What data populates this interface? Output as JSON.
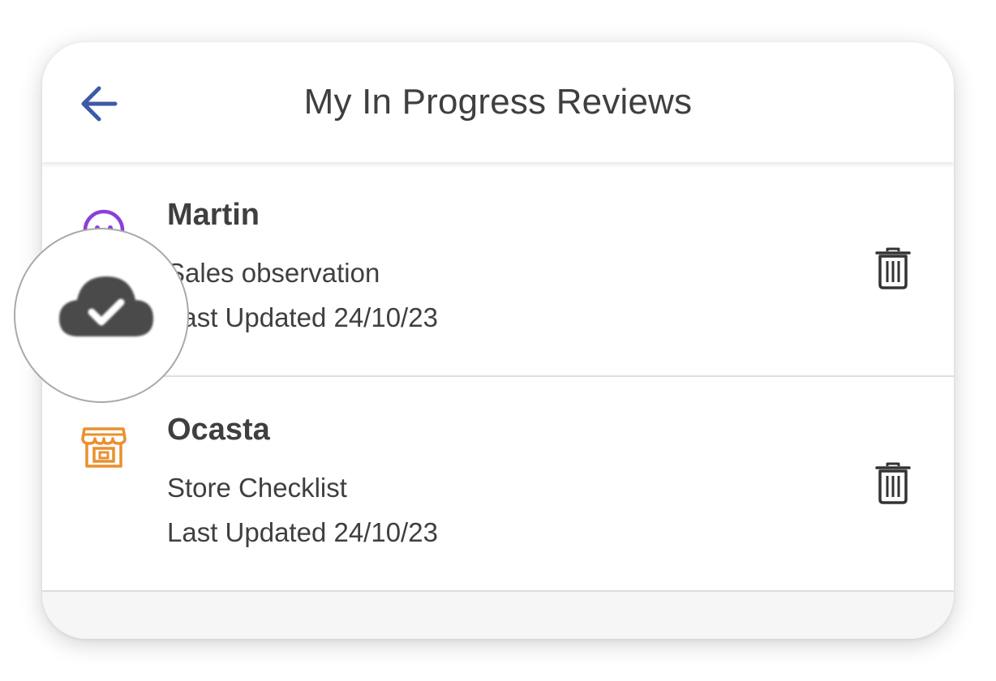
{
  "header": {
    "title": "My In Progress Reviews",
    "back_icon": "arrow-left-icon",
    "back_color": "#3d5aa6"
  },
  "reviews": [
    {
      "name": "Martin",
      "type": "Sales observation",
      "updated": "Last Updated 24/10/23",
      "icon": "smiley-face-icon",
      "icon_color": "#8b3fd9",
      "action_icon": "trash-icon"
    },
    {
      "name": "Ocasta",
      "type": "Store Checklist",
      "updated": "Last Updated 24/10/23",
      "icon": "storefront-icon",
      "icon_color": "#e8912f",
      "action_icon": "trash-icon"
    }
  ],
  "overlay": {
    "icon": "cloud-check-icon",
    "color": "#4a4a4a"
  }
}
